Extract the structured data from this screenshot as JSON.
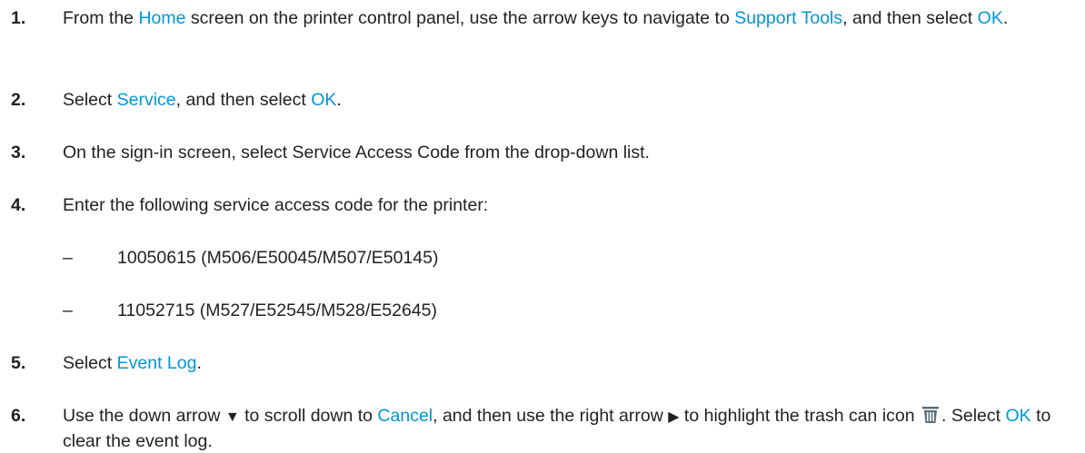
{
  "steps": [
    {
      "number": "1.",
      "parts": [
        "From the ",
        "Home",
        " screen on the printer control panel, use the arrow keys to navigate to ",
        "Support Tools",
        ", and then select ",
        "OK",
        "."
      ]
    },
    {
      "number": "2.",
      "parts": [
        "Select ",
        "Service",
        ", and then select ",
        "OK",
        "."
      ]
    },
    {
      "number": "3.",
      "text": "On the sign-in screen, select Service Access Code from the drop-down list."
    },
    {
      "number": "4.",
      "text": "Enter the following service access code for the printer:",
      "codes": [
        {
          "dash": "–",
          "text": "10050615 (M506/E50045/M507/E50145)"
        },
        {
          "dash": "–",
          "text": "11052715 (M527/E52545/M528/E52645)"
        }
      ]
    },
    {
      "number": "5.",
      "parts": [
        "Select ",
        "Event Log",
        "."
      ]
    },
    {
      "number": "6.",
      "parts": [
        "Use the down arrow ",
        "▼",
        " to scroll down to ",
        "Cancel",
        ", and then use the right arrow ",
        "▶",
        " to highlight the trash can icon ",
        ". Select ",
        "OK",
        " to clear the event log."
      ]
    }
  ],
  "colors": {
    "text": "#231f20",
    "highlight": "#0096d6",
    "icon": "#5a6f7c"
  },
  "icons": {
    "trash": "trash-can-icon",
    "down_arrow": "down-arrow-icon",
    "right_arrow": "right-arrow-icon"
  }
}
